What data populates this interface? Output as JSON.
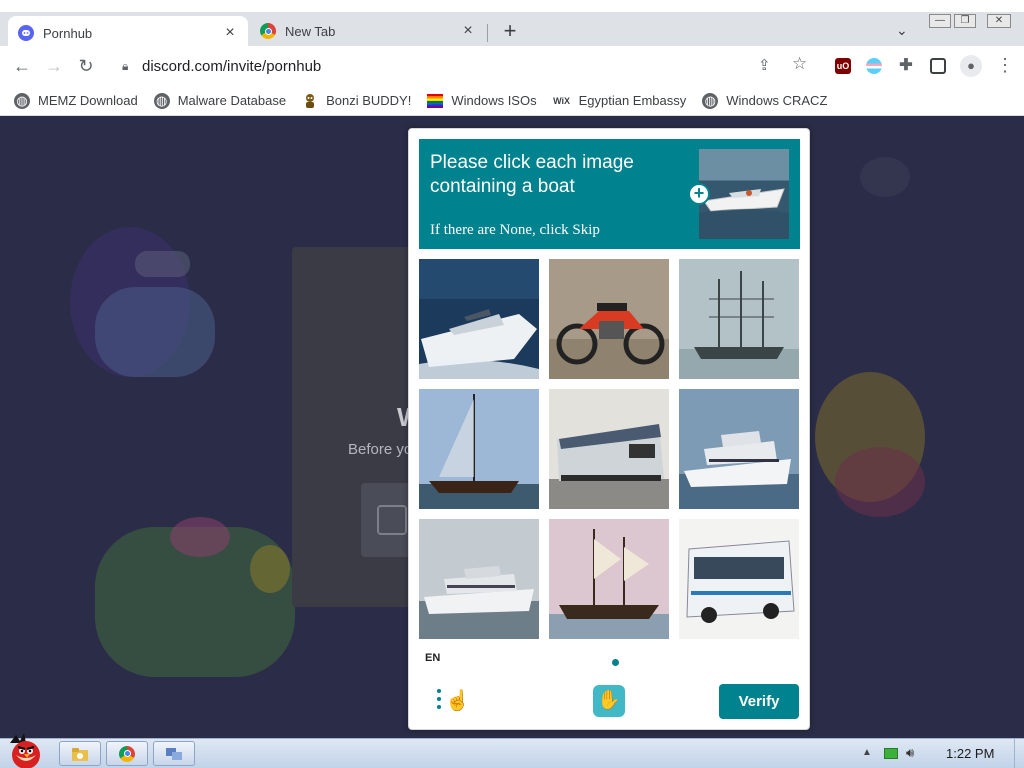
{
  "tabs": [
    {
      "title": "Pornhub",
      "close": "×"
    },
    {
      "title": "New Tab",
      "close": "×"
    }
  ],
  "new_tab_symbol": "+",
  "window_controls": {
    "minimize": "▭",
    "maximize": "▭",
    "close": "✕"
  },
  "omnibox": {
    "url": "discord.com/invite/pornhub"
  },
  "bookmarks": [
    {
      "label": "MEMZ Download",
      "icon": "globe-icon"
    },
    {
      "label": "Malware Database",
      "icon": "globe-icon"
    },
    {
      "label": "Bonzi BUDDY!",
      "icon": "bonzi-icon"
    },
    {
      "label": "Windows ISOs",
      "icon": "windows-flag-icon"
    },
    {
      "label": "Egyptian Embassy",
      "icon": "wix-icon"
    },
    {
      "label": "Windows CRACZ",
      "icon": "globe-icon"
    }
  ],
  "wix_text": "WiX",
  "background_page": {
    "heading": "W",
    "subtext": "Before yo"
  },
  "captcha": {
    "prompt": "Please click each image containing a boat",
    "hint": "If there are None, click Skip",
    "example_plus": "+",
    "images": [
      {
        "subject": "boat",
        "icon": "motor-yacht-image"
      },
      {
        "subject": "motorcycle",
        "icon": "motorcycle-image"
      },
      {
        "subject": "boat",
        "icon": "tall-ship-image"
      },
      {
        "subject": "boat",
        "icon": "sailboat-image"
      },
      {
        "subject": "train",
        "icon": "locomotive-image"
      },
      {
        "subject": "boat",
        "icon": "white-yacht-image"
      },
      {
        "subject": "boat",
        "icon": "motor-yacht-image"
      },
      {
        "subject": "boat",
        "icon": "pirate-ship-image"
      },
      {
        "subject": "bus",
        "icon": "bus-image"
      }
    ],
    "language": "EN",
    "verify_label": "Verify"
  },
  "taskbar": {
    "clock": "1:22 PM",
    "tray_expand": "▲"
  },
  "colors": {
    "captcha_accent": "#00838f",
    "page_background": "#2b2d48"
  }
}
